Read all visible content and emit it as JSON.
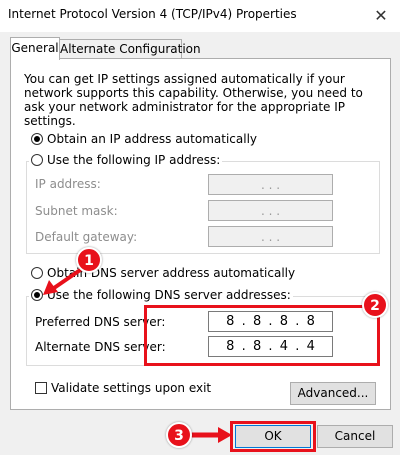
{
  "window": {
    "title": "Internet Protocol Version 4 (TCP/IPv4) Properties",
    "close_glyph": "✕"
  },
  "tabs": [
    {
      "label": "General",
      "active": true
    },
    {
      "label": "Alternate Configuration",
      "active": false
    }
  ],
  "description": "You can get IP settings assigned automatically if your network supports this capability. Otherwise, you need to ask your network administrator for the appropriate IP settings.",
  "ip_section": {
    "obtain_auto_label": "Obtain an IP address automatically",
    "use_following_label": "Use the following IP address:",
    "selected": "auto",
    "fields": [
      {
        "label": "IP address:",
        "value": ". . ."
      },
      {
        "label": "Subnet mask:",
        "value": ". . ."
      },
      {
        "label": "Default gateway:",
        "value": ". . ."
      }
    ]
  },
  "dns_section": {
    "obtain_auto_label": "Obtain DNS server address automatically",
    "use_following_label": "Use the following DNS server addresses:",
    "selected": "manual",
    "preferred_label": "Preferred DNS server:",
    "preferred_octets": [
      "8",
      "8",
      "8",
      "8"
    ],
    "alternate_label": "Alternate DNS server:",
    "alternate_octets": [
      "8",
      "8",
      "4",
      "4"
    ]
  },
  "validate_label": "Validate settings upon exit",
  "validate_checked": false,
  "buttons": {
    "advanced": "Advanced...",
    "ok": "OK",
    "cancel": "Cancel"
  },
  "annotations": {
    "badge_1": "1",
    "badge_2": "2",
    "badge_3": "3",
    "color": "#e8111b"
  }
}
